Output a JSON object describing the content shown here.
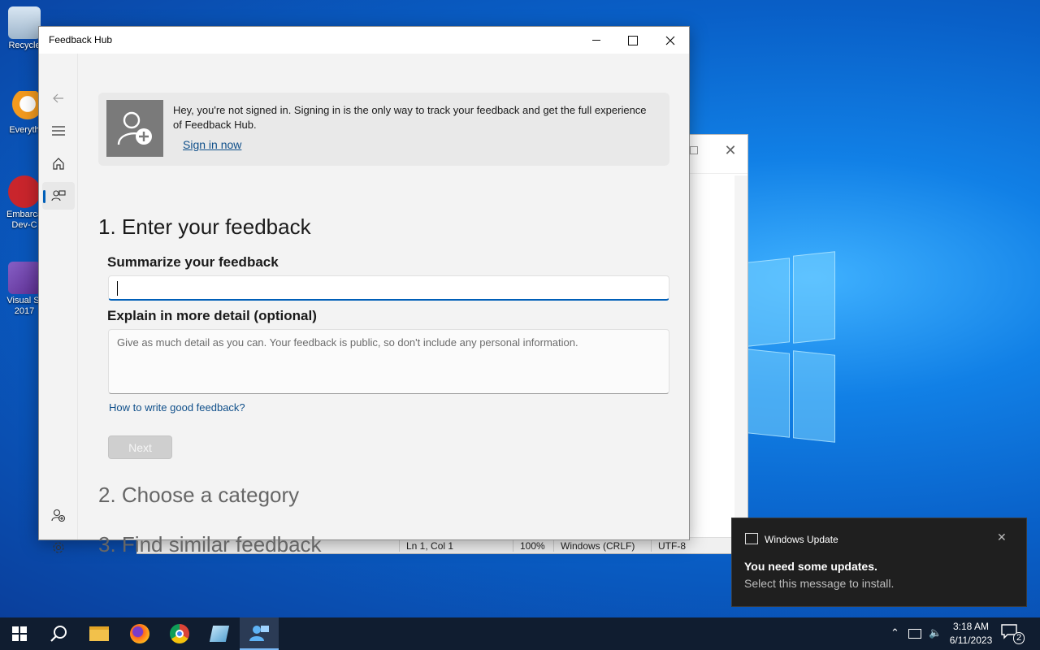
{
  "desktop": {
    "icons": [
      {
        "label": "Recycle",
        "name": "recycle-bin"
      },
      {
        "label": "Everyth",
        "name": "everything"
      },
      {
        "label": "Embarca Dev-C",
        "name": "embarcadero-dev-cpp"
      },
      {
        "label": "Visual St 2017",
        "name": "visual-studio-2017"
      }
    ]
  },
  "notepad": {
    "status": {
      "position": "Ln 1, Col 1",
      "zoom": "100%",
      "line_ending": "Windows (CRLF)",
      "encoding": "UTF-8"
    }
  },
  "feedback_hub": {
    "window_title": "Feedback Hub",
    "banner": {
      "message": "Hey, you're not signed in. Signing in is the only way to track your feedback and get the full experience of Feedback Hub.",
      "sign_in_link": "Sign in now"
    },
    "step1": {
      "heading": "1. Enter your feedback",
      "summary_label": "Summarize your feedback",
      "summary_value": "",
      "detail_label": "Explain in more detail (optional)",
      "detail_placeholder": "Give as much detail as you can. Your feedback is public, so don't include any personal information.",
      "howto_link": "How to write good feedback?",
      "next_label": "Next"
    },
    "step2_heading": "2. Choose a category",
    "step3_heading": "3. Find similar feedback"
  },
  "toast": {
    "app": "Windows Update",
    "title": "You need some updates.",
    "body": "Select this message to install."
  },
  "taskbar": {
    "time": "3:18 AM",
    "date": "6/11/2023",
    "notification_count": "2"
  }
}
